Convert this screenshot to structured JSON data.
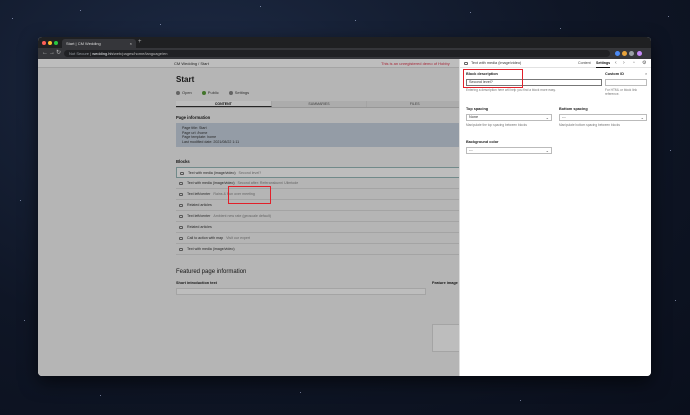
{
  "browser": {
    "tab_title": "Start | CM Wedding",
    "tab_close": "×",
    "new_tab": "+",
    "url_secure": "Not Secure",
    "url_host": "wedding.hh",
    "url_path": "/web/pages/home/language/en"
  },
  "app": {
    "crumbs": "CM Wedding  /  Start",
    "env_warning": "This is an unregistered demo of Hobby"
  },
  "page": {
    "title": "Start",
    "actions": [
      {
        "label": "Open",
        "color": "#888888"
      },
      {
        "label": "Public",
        "color": "#5a9e3a"
      },
      {
        "label": "Settings",
        "color": "#888888"
      }
    ],
    "tabs": [
      {
        "label": "CONTENT",
        "active": true
      },
      {
        "label": "SUMMARIES",
        "active": false
      },
      {
        "label": "FILES",
        "active": false
      }
    ],
    "info_heading": "Page information",
    "info_lines": [
      "Page title: Start",
      "Page url: /home",
      "Page template: home",
      "Last modified date: 2021/08/22 1:11"
    ],
    "blocks_heading": "Blocks",
    "blocks": [
      {
        "label": "Text with media (image/video)",
        "sub": "Second level?",
        "selected": true
      },
      {
        "label": "Text with media (image/video)",
        "sub": "Second after: Referanskunni Ulimtode",
        "selected": false
      },
      {
        "label": "Text left/center",
        "sub": "Rains & Fun over meeting",
        "selected": false
      },
      {
        "label": "Related articles",
        "sub": "",
        "selected": false
      },
      {
        "label": "Text left/center",
        "sub": "Ambient new rate (geoscale default)",
        "selected": false
      },
      {
        "label": "Related articles",
        "sub": "",
        "selected": false
      },
      {
        "label": "Call to action with map",
        "sub": "Visit our expert",
        "selected": false
      },
      {
        "label": "Text with media (image/video)",
        "sub": "",
        "selected": false
      }
    ],
    "featured_heading": "Featured page information",
    "short_intro_label": "Short introduction text",
    "feature_image_label": "Feature image"
  },
  "panel": {
    "title": "Text with media (image/video)",
    "tab_content": "Content",
    "tab_settings": "Settings",
    "block_description_label": "Block description",
    "block_description_value": "Second level?",
    "block_description_help": "Entering a description here will help you find a block more easy.",
    "custom_id_label": "Custom ID",
    "custom_id_help": "For HTML or block link reference.",
    "top_spacing_label": "Top spacing",
    "top_spacing_value": "None",
    "top_spacing_help": "Manipulate the top spacing between blocks",
    "bottom_spacing_label": "Bottom spacing",
    "bottom_spacing_value": "---",
    "bottom_spacing_help": "Manipulate bottom spacing between blocks",
    "background_color_label": "Background color",
    "background_color_value": "---",
    "clear_char": "×"
  }
}
